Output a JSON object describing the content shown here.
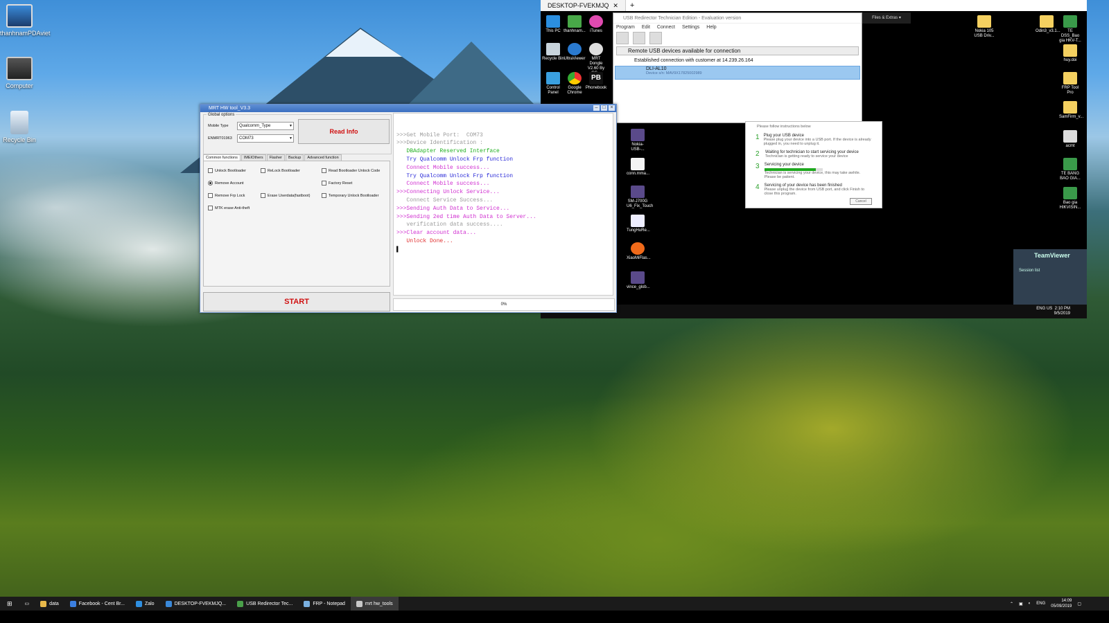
{
  "desktop": {
    "icons": [
      {
        "label": "thanhnamPDAviet"
      },
      {
        "label": "Computer"
      },
      {
        "label": "Recycle Bin"
      }
    ]
  },
  "remote": {
    "tab_title": "DESKTOP-FVEKMJQ",
    "icons_col": [
      {
        "label": "This PC"
      },
      {
        "label": "thanhnam..."
      },
      {
        "label": "iTunes"
      },
      {
        "label": "Recycle Bin"
      },
      {
        "label": "UltraViewer"
      },
      {
        "label": "MRT Dongle V2.60 By GS..."
      },
      {
        "label": "Control Panel"
      },
      {
        "label": "Google Chrome"
      },
      {
        "label": "Phonebook"
      }
    ],
    "icons_mid": [
      {
        "label": "Nokia-USB-..."
      },
      {
        "label": "conn.mma..."
      },
      {
        "label": "SM-J700G U6_Fix_Touch"
      },
      {
        "label": "TungHuRe..."
      },
      {
        "label": "XiaoMiFlas..."
      },
      {
        "label": "vince_glob..."
      }
    ],
    "icons_right": [
      {
        "label": "Nokia 105 USB Driv..."
      },
      {
        "label": "Odin3_v3.1..."
      },
      {
        "label": "TE DSS_Bao gia HKV-T..."
      },
      {
        "label": "huy.doi"
      },
      {
        "label": "FRP Tool Pro"
      },
      {
        "label": "SamFirm_v..."
      },
      {
        "label": "acmt"
      },
      {
        "label": "TE BANG BAO GIA..."
      },
      {
        "label": "Bao gia HIKVISIN..."
      }
    ],
    "files_extras": "Files & Extras",
    "usb": {
      "title": "USB Redirector Technician Edition - Evaluation version",
      "menu": [
        "Program",
        "Edit",
        "Connect",
        "Settings",
        "Help"
      ],
      "panel_title": "Remote USB devices available for connection",
      "connection": "Established connection with customer at 14.239.26.164",
      "device_name": "DLI-AL10",
      "device_sub": "Device s/n: MAV9X17825002989"
    },
    "instructions": {
      "header": "Please follow instructions below",
      "steps": [
        {
          "n": "1",
          "title": "Plug your USB device",
          "desc": "Please plug your device into a USB port. If the device is already plugged in, you need to unplug it."
        },
        {
          "n": "2",
          "title": "Waiting for technician to start servicing your device",
          "desc": "Technician is getting ready to service your device"
        },
        {
          "n": "3",
          "title": "Servicing your device",
          "desc": "Technician is servicing your device, this may take awhile. Please be patient."
        },
        {
          "n": "4",
          "title": "Servicing of your device has been finished",
          "desc": "Please unplug the device from USB port, and click Finish to close this program."
        }
      ],
      "progress": 0.88,
      "cancel": "Cancel"
    },
    "teamviewer": {
      "title": "TeamViewer",
      "session": "Session list"
    },
    "tray": {
      "lang": "ENG US",
      "time": "2:10 PM",
      "date": "9/5/2019"
    }
  },
  "mrt": {
    "title": "MRT HW tool_V3.3",
    "global_options": "Global options",
    "mobile_type_label": "Mobile Type",
    "mobile_type_value": "Qualcomm_Type",
    "port_label": "ENMRT01963",
    "port_value": "COM73",
    "read_info": "Read Info",
    "tabs": [
      "Common functions",
      "IMEIOthers",
      "Flasher",
      "Backup",
      "Advanced function"
    ],
    "options": [
      {
        "label": "Unlock Bootloader",
        "kind": "box"
      },
      {
        "label": "ReLock Bootloader",
        "kind": "box"
      },
      {
        "label": "Read Bootloader Unlock Code",
        "kind": "box"
      },
      {
        "label": "Remove Account",
        "kind": "radio",
        "checked": true
      },
      {
        "label": "Factory Reset",
        "kind": "box"
      },
      {
        "label": "Remove Frp Lock",
        "kind": "box"
      },
      {
        "label": "Erase Userdata(fastboot)",
        "kind": "box"
      },
      {
        "label": "Temporary Unlock Bootloader",
        "kind": "box"
      },
      {
        "label": "MTK erase Anti-theft",
        "kind": "box"
      }
    ],
    "start": "START",
    "progress": "0%",
    "log": [
      {
        "text": ">>>Get Mobile Port:  COM73",
        "color": "#9a9a9a"
      },
      {
        "text": ">>>Device Identification :",
        "color": "#9a9a9a"
      },
      {
        "text": "   DBAdapter Reserved Interface",
        "color": "#22b022"
      },
      {
        "text": "   Try Qualcomm Unlock Frp function",
        "color": "#2a2ad8"
      },
      {
        "text": "   Connect Mobile success...",
        "color": "#d02fd0"
      },
      {
        "text": "   Try Qualcomm Unlock Frp function",
        "color": "#2a2ad8"
      },
      {
        "text": "   Connect Mobile success...",
        "color": "#d02fd0"
      },
      {
        "text": ">>>Connecting Unlock Service...",
        "color": "#d02fd0"
      },
      {
        "text": "   Connect Service Success...",
        "color": "#9a9a9a"
      },
      {
        "text": ">>>Sending Auth Data to Service...",
        "color": "#d02fd0"
      },
      {
        "text": ">>>Sending 2ed time Auth Data to Server...",
        "color": "#d02fd0"
      },
      {
        "text": "   verification data success....",
        "color": "#9a9a9a"
      },
      {
        "text": ">>>Clear account data...",
        "color": "#d02fd0"
      },
      {
        "text": "   Unlock Done...",
        "color": "#e03030"
      }
    ]
  },
  "taskbar": {
    "items": [
      {
        "label": "data",
        "color": "#e8b84a"
      },
      {
        "label": "Facebook - Cent Br...",
        "color": "#3b7fe0"
      },
      {
        "label": "Zalo",
        "color": "#2f8fe0"
      },
      {
        "label": "DESKTOP-FVEKMJQ...",
        "color": "#3a88d8"
      },
      {
        "label": "USB Redirector Tec...",
        "color": "#4aa04a"
      },
      {
        "label": "FRP - Notepad",
        "color": "#7ab0e0"
      },
      {
        "label": "mrt hw_tools",
        "color": "#c8c8c8"
      }
    ],
    "lang": "ENG",
    "time": "14:09",
    "date": "05/09/2019"
  }
}
